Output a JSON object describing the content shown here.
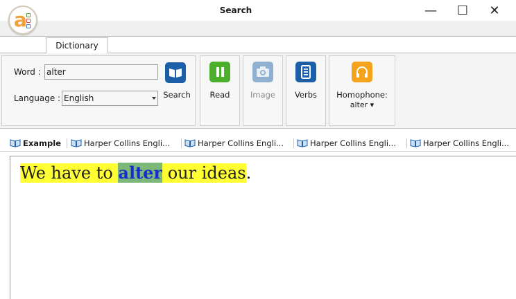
{
  "window": {
    "title": "Search",
    "controls": {
      "minimize": "—",
      "maximize": "☐",
      "close": "✕"
    }
  },
  "tabs": {
    "main": "Dictionary"
  },
  "form": {
    "word_label": "Word :",
    "word_value": "alter",
    "language_label": "Language :",
    "language_value": "English"
  },
  "toolbar": {
    "search_label": "Search",
    "read_label": "Read",
    "image_label": "Image",
    "verbs_label": "Verbs",
    "homophone_label": "Homophone:",
    "homophone_value": "alter ▾"
  },
  "subtabs": [
    {
      "label": "Example"
    },
    {
      "label": "Harper Collins Engli..."
    },
    {
      "label": "Harper Collins Engli..."
    },
    {
      "label": "Harper Collins Engli..."
    },
    {
      "label": "Harper Collins Engli..."
    }
  ],
  "example": {
    "before": "We have to ",
    "highlight": "alter",
    "after": " our ideas",
    "period": "."
  },
  "colors": {
    "search_icon": "#1b5fa8",
    "read_icon": "#4caf2c",
    "image_icon": "#7f9fbf",
    "verbs_icon": "#1b5fa8",
    "homophone_icon": "#f4a31c",
    "highlight_bg": "#ffff33",
    "keyword_bg": "#7cb87a",
    "keyword_fg": "#1a2ad1"
  }
}
